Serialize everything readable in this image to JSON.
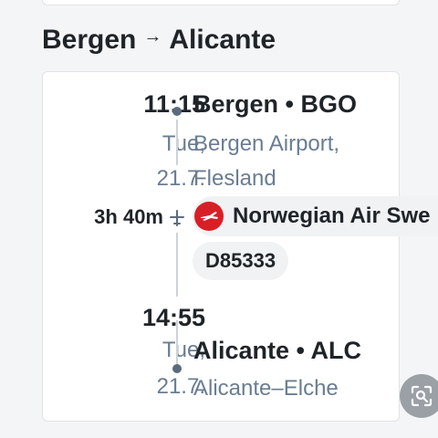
{
  "route": {
    "origin": "Bergen",
    "arrow": "→",
    "destination": "Alicante"
  },
  "departure": {
    "time": "11:15",
    "weekday": "Tue,",
    "date": "21.7.",
    "place": "Bergen • BGO",
    "airport_line1": "Bergen Airport,",
    "airport_line2": "Flesland"
  },
  "segment": {
    "duration": "3h 40m",
    "airline": "Norwegian Air Swe",
    "flight_number": "D85333",
    "airline_color": "#d81f26"
  },
  "arrival": {
    "time": "14:55",
    "weekday": "Tue,",
    "date": "21.7.",
    "place": "Alicante • ALC",
    "airport": "Alicante–Elche"
  },
  "icons": {
    "plane": "plane-icon",
    "airline_logo": "norwegian-logo-icon",
    "lens": "lens-search-icon"
  },
  "colors": {
    "text": "#1f2429",
    "muted": "#6a7d91",
    "timeline": "#cdd3da"
  }
}
